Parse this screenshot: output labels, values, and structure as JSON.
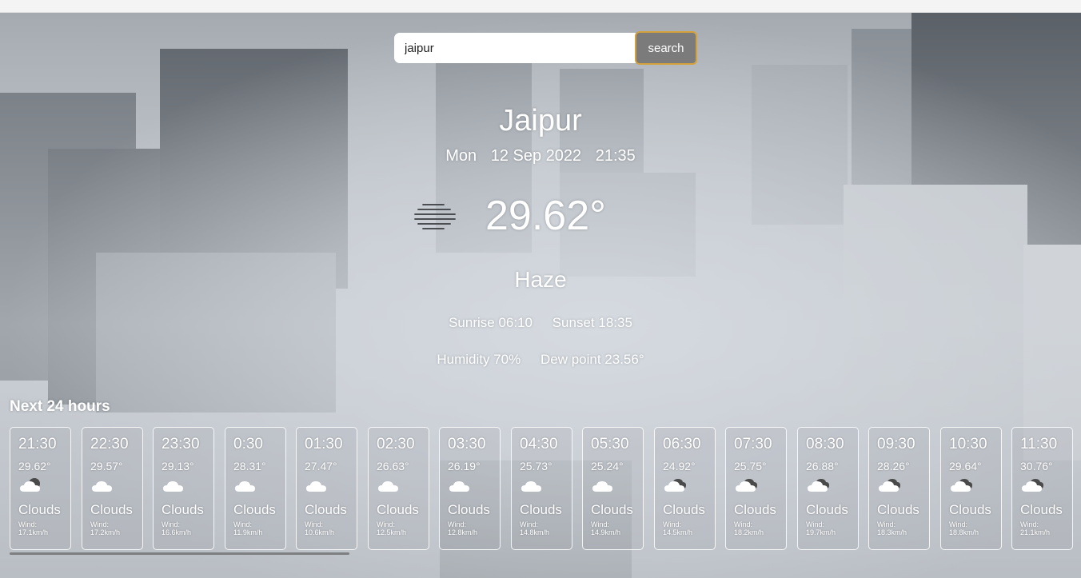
{
  "search": {
    "value": "jaipur",
    "button_label": "search"
  },
  "current": {
    "city": "Jaipur",
    "day": "Mon",
    "date": "12 Sep 2022",
    "time": "21:35",
    "temperature": "29.62°",
    "condition": "Haze",
    "icon": "haze-icon",
    "sunrise": "Sunrise 06:10",
    "sunset": "Sunset 18:35",
    "humidity": "Humidity 70%",
    "dew_point": "Dew point 23.56°"
  },
  "forecast": {
    "title": "Next 24 hours",
    "wind_label": "Wind:",
    "items": [
      {
        "time": "21:30",
        "temp": "29.62°",
        "cond": "Clouds",
        "wind": "17.1km/h",
        "icon": "partly-cloudy-night-icon"
      },
      {
        "time": "22:30",
        "temp": "29.57°",
        "cond": "Clouds",
        "wind": "17.2km/h",
        "icon": "cloud-icon"
      },
      {
        "time": "23:30",
        "temp": "29.13°",
        "cond": "Clouds",
        "wind": "16.6km/h",
        "icon": "cloud-icon"
      },
      {
        "time": "0:30",
        "temp": "28.31°",
        "cond": "Clouds",
        "wind": "11.9km/h",
        "icon": "cloud-icon"
      },
      {
        "time": "01:30",
        "temp": "27.47°",
        "cond": "Clouds",
        "wind": "10.6km/h",
        "icon": "cloud-icon"
      },
      {
        "time": "02:30",
        "temp": "26.63°",
        "cond": "Clouds",
        "wind": "12.5km/h",
        "icon": "cloud-icon"
      },
      {
        "time": "03:30",
        "temp": "26.19°",
        "cond": "Clouds",
        "wind": "12.8km/h",
        "icon": "cloud-icon"
      },
      {
        "time": "04:30",
        "temp": "25.73°",
        "cond": "Clouds",
        "wind": "14.8km/h",
        "icon": "cloud-icon"
      },
      {
        "time": "05:30",
        "temp": "25.24°",
        "cond": "Clouds",
        "wind": "14.9km/h",
        "icon": "cloud-icon"
      },
      {
        "time": "06:30",
        "temp": "24.92°",
        "cond": "Clouds",
        "wind": "14.5km/h",
        "icon": "broken-clouds-icon"
      },
      {
        "time": "07:30",
        "temp": "25.75°",
        "cond": "Clouds",
        "wind": "18.2km/h",
        "icon": "broken-clouds-icon"
      },
      {
        "time": "08:30",
        "temp": "26.88°",
        "cond": "Clouds",
        "wind": "19.7km/h",
        "icon": "broken-clouds-icon"
      },
      {
        "time": "09:30",
        "temp": "28.26°",
        "cond": "Clouds",
        "wind": "18.3km/h",
        "icon": "broken-clouds-icon"
      },
      {
        "time": "10:30",
        "temp": "29.64°",
        "cond": "Clouds",
        "wind": "18.8km/h",
        "icon": "broken-clouds-icon"
      },
      {
        "time": "11:30",
        "temp": "30.76°",
        "cond": "Clouds",
        "wind": "21.1km/h",
        "icon": "broken-clouds-icon"
      }
    ]
  },
  "colors": {
    "button_bg": "#7b7b7b",
    "button_border": "#d4a23c",
    "text": "#ffffff"
  }
}
